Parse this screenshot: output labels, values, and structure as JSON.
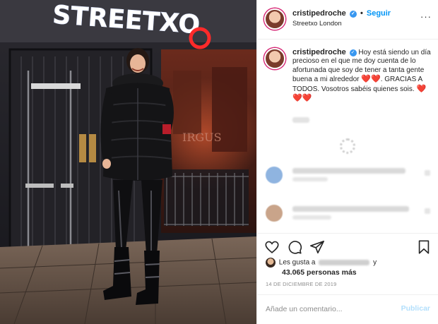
{
  "post": {
    "username": "cristipedroche",
    "verified": true,
    "separator": "•",
    "follow_label": "Seguir",
    "location": "Streetxo London",
    "more_icon": "more-options-icon"
  },
  "photo": {
    "neon_sign": "STREETXO"
  },
  "caption": {
    "username": "cristipedroche",
    "text_part1": "Hoy está siendo un día precioso en el que me doy cuenta de lo afortunada que soy de tener a tanta gente buena a mi alrededor",
    "text_part2": ". GRACIAS A TODOS. Vosotros sabéis quienes sois.",
    "hearts_inline": "❤️❤️",
    "hearts_end": "❤️❤️❤️"
  },
  "actions": {
    "like_icon": "heart-icon",
    "comment_icon": "comment-icon",
    "share_icon": "share-icon",
    "save_icon": "bookmark-icon"
  },
  "likes": {
    "prefix": "Les gusta a",
    "suffix": "y",
    "count": "43.065 personas más"
  },
  "date": "14 DE DICIEMBRE DE 2019",
  "comment_box": {
    "placeholder": "Añade un comentario...",
    "publish_label": "Publicar"
  },
  "colors": {
    "follow": "#0095f6",
    "heart": "#e0245e",
    "publish_disabled": "#b2dffc",
    "neon": "#ffffff",
    "neon_red": "#ff2a2a"
  }
}
